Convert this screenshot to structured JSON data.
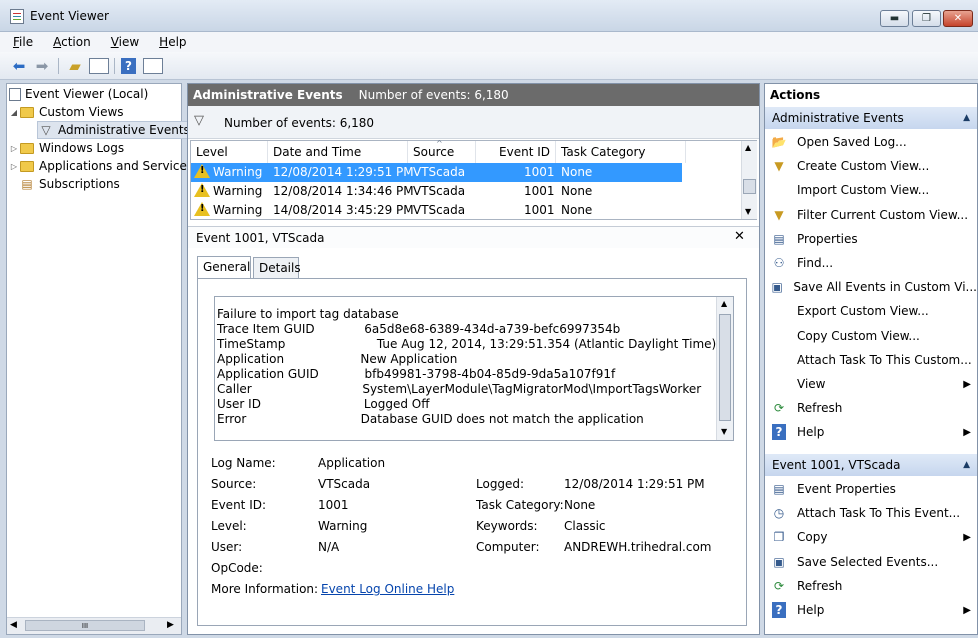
{
  "window": {
    "title": "Event Viewer",
    "min": "▬",
    "max": "❐",
    "close": "✕"
  },
  "menu": [
    {
      "label": "File",
      "key": "F",
      "rest": "ile"
    },
    {
      "label": "Action",
      "key": "A",
      "rest": "ction"
    },
    {
      "label": "View",
      "key": "V",
      "rest": "iew"
    },
    {
      "label": "Help",
      "key": "H",
      "rest": "elp"
    }
  ],
  "toolbar": {
    "icons": [
      "back-arrow-icon",
      "forward-arrow-icon",
      "up-folder-icon",
      "show-hide-tree-icon",
      "help-icon",
      "show-hide-action-pane-icon"
    ]
  },
  "nav": {
    "root": "Event Viewer (Local)",
    "custom_views": "Custom Views",
    "admin_events": "Administrative Events",
    "windows_logs": "Windows Logs",
    "apps_services": "Applications and Services",
    "subscriptions": "Subscriptions",
    "scroll_grip": "III"
  },
  "center": {
    "header_title": "Administrative Events",
    "header_count": "Number of events: 6,180",
    "filter_count": "Number of events: 6,180",
    "columns": {
      "level": "Level",
      "date": "Date and Time",
      "source": "Source",
      "event_id": "Event ID",
      "task": "Task Category"
    },
    "rows": [
      {
        "level": "Warning",
        "date": "12/08/2014 1:29:51 PM",
        "source": "VTScada",
        "event_id": "1001",
        "task": "None"
      },
      {
        "level": "Warning",
        "date": "12/08/2014 1:34:46 PM",
        "source": "VTScada",
        "event_id": "1001",
        "task": "None"
      },
      {
        "level": "Warning",
        "date": "14/08/2014 3:45:29 PM",
        "source": "VTScada",
        "event_id": "1001",
        "task": "None"
      }
    ]
  },
  "detail": {
    "title": "Event 1001, VTScada",
    "close": "✕",
    "tabs": [
      "General",
      "Details"
    ],
    "message": [
      "Failure to import tag database",
      "Trace Item GUID             6a5d8e68-6389-434d-a739-befc6997354b",
      "TimeStamp                        Tue Aug 12, 2014, 13:29:51.354 (Atlantic Daylight Time)",
      "Application                    New Application",
      "Application GUID            bfb49981-3798-4b04-85d9-9da5a107f91f",
      "Caller                             System\\LayerModule\\TagMigratorMod\\ImportTagsWorker",
      "User ID                           Logged Off",
      "Error                              Database GUID does not match the application"
    ],
    "props": {
      "log_name_label": "Log Name:",
      "log_name": "Application",
      "source_label": "Source:",
      "source": "VTScada",
      "logged_label": "Logged:",
      "logged": "12/08/2014 1:29:51 PM",
      "event_id_label": "Event ID:",
      "event_id": "1001",
      "task_label": "Task Category:",
      "task": "None",
      "level_label": "Level:",
      "level": "Warning",
      "keywords_label": "Keywords:",
      "keywords": "Classic",
      "user_label": "User:",
      "user": "N/A",
      "computer_label": "Computer:",
      "computer": "ANDREWH.trihedral.com",
      "opcode_label": "OpCode:",
      "more_label": "More Information:",
      "more_link": "Event Log Online Help"
    }
  },
  "actions": {
    "title": "Actions",
    "section1": "Administrative Events",
    "items1": [
      {
        "label": "Open Saved Log...",
        "icon": "open-folder-icon",
        "glyph": "📂"
      },
      {
        "label": "Create Custom View...",
        "icon": "filter-create-icon",
        "glyph": "▼"
      },
      {
        "label": "Import Custom View...",
        "icon": "blank-icon",
        "glyph": ""
      },
      {
        "label": "Filter Current Custom View...",
        "icon": "filter-icon",
        "glyph": "▼"
      },
      {
        "label": "Properties",
        "icon": "properties-icon",
        "glyph": "▤"
      },
      {
        "label": "Find...",
        "icon": "binoculars-icon",
        "glyph": "⚇"
      },
      {
        "label": "Save All Events in Custom Vi...",
        "icon": "save-icon",
        "glyph": "▣"
      },
      {
        "label": "Export Custom View...",
        "icon": "blank-icon",
        "glyph": ""
      },
      {
        "label": "Copy Custom View...",
        "icon": "blank-icon",
        "glyph": ""
      },
      {
        "label": "Attach Task To This Custom...",
        "icon": "blank-icon",
        "glyph": ""
      },
      {
        "label": "View",
        "icon": "blank-icon",
        "glyph": "",
        "sub": "▶"
      },
      {
        "label": "Refresh",
        "icon": "refresh-icon",
        "glyph": "⟳"
      },
      {
        "label": "Help",
        "icon": "help-icon",
        "glyph": "?",
        "sub": "▶"
      }
    ],
    "section2": "Event 1001, VTScada",
    "items2": [
      {
        "label": "Event Properties",
        "icon": "properties-icon",
        "glyph": "▤"
      },
      {
        "label": "Attach Task To This Event...",
        "icon": "clock-task-icon",
        "glyph": "◷"
      },
      {
        "label": "Copy",
        "icon": "copy-icon",
        "glyph": "❐",
        "sub": "▶"
      },
      {
        "label": "Save Selected Events...",
        "icon": "save-icon",
        "glyph": "▣"
      },
      {
        "label": "Refresh",
        "icon": "refresh-icon",
        "glyph": "⟳"
      },
      {
        "label": "Help",
        "icon": "help-icon",
        "glyph": "?",
        "sub": "▶"
      }
    ]
  }
}
